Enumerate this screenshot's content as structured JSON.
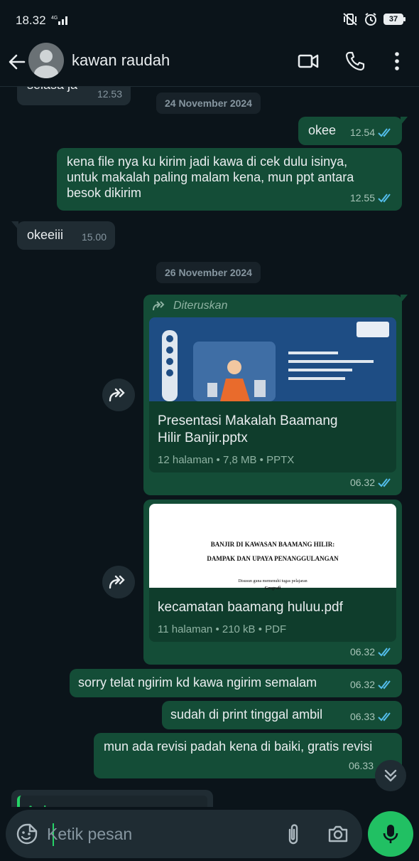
{
  "status": {
    "time": "18.32",
    "network": "4G",
    "battery": "37"
  },
  "header": {
    "contact_name": "kawan raudah"
  },
  "messages": {
    "m0": {
      "text": "selasa ja",
      "time": "12.53"
    },
    "date1": "24 November 2024",
    "m1": {
      "text": "okee",
      "time": "12.54"
    },
    "m2": {
      "lines": [
        "kena file nya ku kirim jadi kawa di cek dulu isinya,",
        "untuk makalah paling malam kena, mun ppt antara",
        "besok dikirim"
      ],
      "time": "12.55"
    },
    "m3": {
      "text": "okeeiii",
      "time": "15.00"
    },
    "date2": "26 November 2024",
    "m4": {
      "forwarded_label": "Diteruskan",
      "file_name_lines": [
        "Presentasi Makalah Baamang",
        "Hilir Banjir.pptx"
      ],
      "file_info": "12 halaman • 7,8 MB • PPTX",
      "time": "06.32"
    },
    "m5": {
      "thumb_title_1": "BANJIR DI KAWASAN BAAMANG HILIR:",
      "thumb_title_2": "DAMPAK DAN UPAYA PENANGGULANGAN",
      "thumb_sub": "Disusun guna memenuhi tugas pelajaran",
      "thumb_subject": "Geografi",
      "file_name": "kecamatan baamang huluu.pdf",
      "file_info": "11 halaman • 210 kB • PDF",
      "time": "06.32"
    },
    "m6": {
      "text": "sorry telat ngirim kd kawa ngirim semalam",
      "time": "06.32"
    },
    "m7": {
      "text": "sudah di print tinggal ambil",
      "time": "06.33"
    },
    "m8": {
      "text": "mun ada revisi padah kena di baiki, gratis revisi",
      "time": "06.33"
    },
    "m9": {
      "quote_sender": "Anda"
    }
  },
  "composer": {
    "placeholder": "Ketik pesan"
  },
  "colors": {
    "bg": "#0b141a",
    "outgoing": "#144d37",
    "incoming": "#202c33",
    "read_tick": "#53bdeb",
    "accent": "#21c063"
  }
}
